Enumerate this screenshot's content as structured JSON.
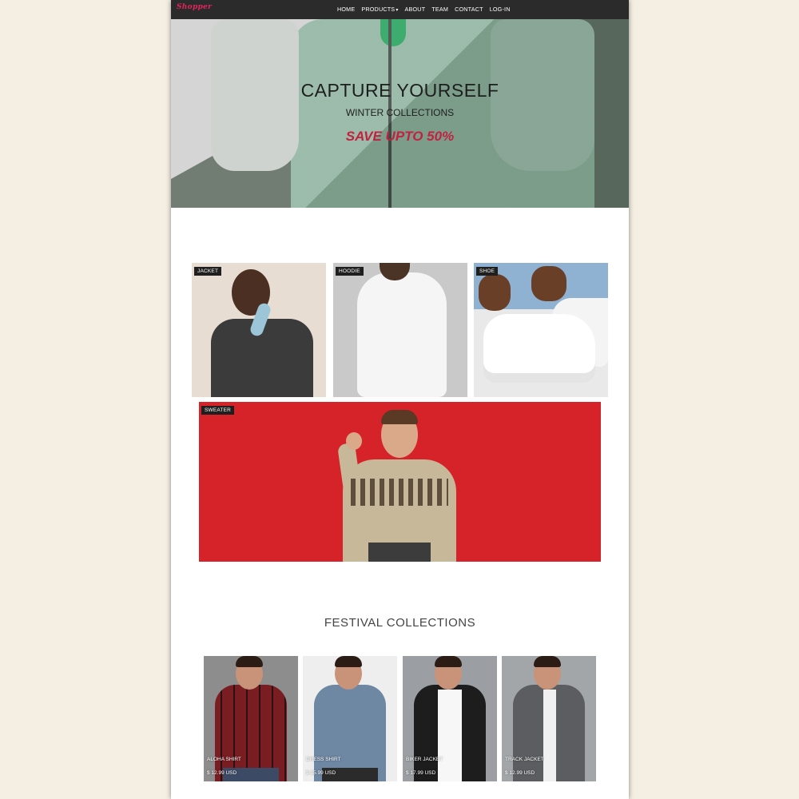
{
  "nav": {
    "brand": "Shopper",
    "links": {
      "home": "HOME",
      "products": "PRODUCTS",
      "about": "ABOUT",
      "team": "TEAM",
      "contact": "CONTACT",
      "login": "LOG-IN"
    }
  },
  "hero": {
    "title": "CAPTURE YOURSELF",
    "subtitle": "WINTER COLLECTIONS",
    "sale": "SAVE UPTO 50%"
  },
  "categories": [
    {
      "label": "JACKET"
    },
    {
      "label": "HOODIE"
    },
    {
      "label": "SHOE"
    },
    {
      "label": "SWEATER"
    }
  ],
  "festival": {
    "title": "FESTIVAL COLLECTIONS",
    "products": [
      {
        "name": "ALOHA SHIRT",
        "price": "$ 12.99 USD"
      },
      {
        "name": "DRESS SHIRT",
        "price": "$ 15.99 USD"
      },
      {
        "name": "BIKER JACKET",
        "price": "$ 17.99 USD"
      },
      {
        "name": "TRACK JACKET",
        "price": "$ 12.99 USD"
      }
    ]
  },
  "colors": {
    "background": "#f5efe3",
    "nav": "#2b2b2b",
    "brand": "#e0245e",
    "sale": "#c2213f",
    "sweater_bg": "#d6232a"
  }
}
